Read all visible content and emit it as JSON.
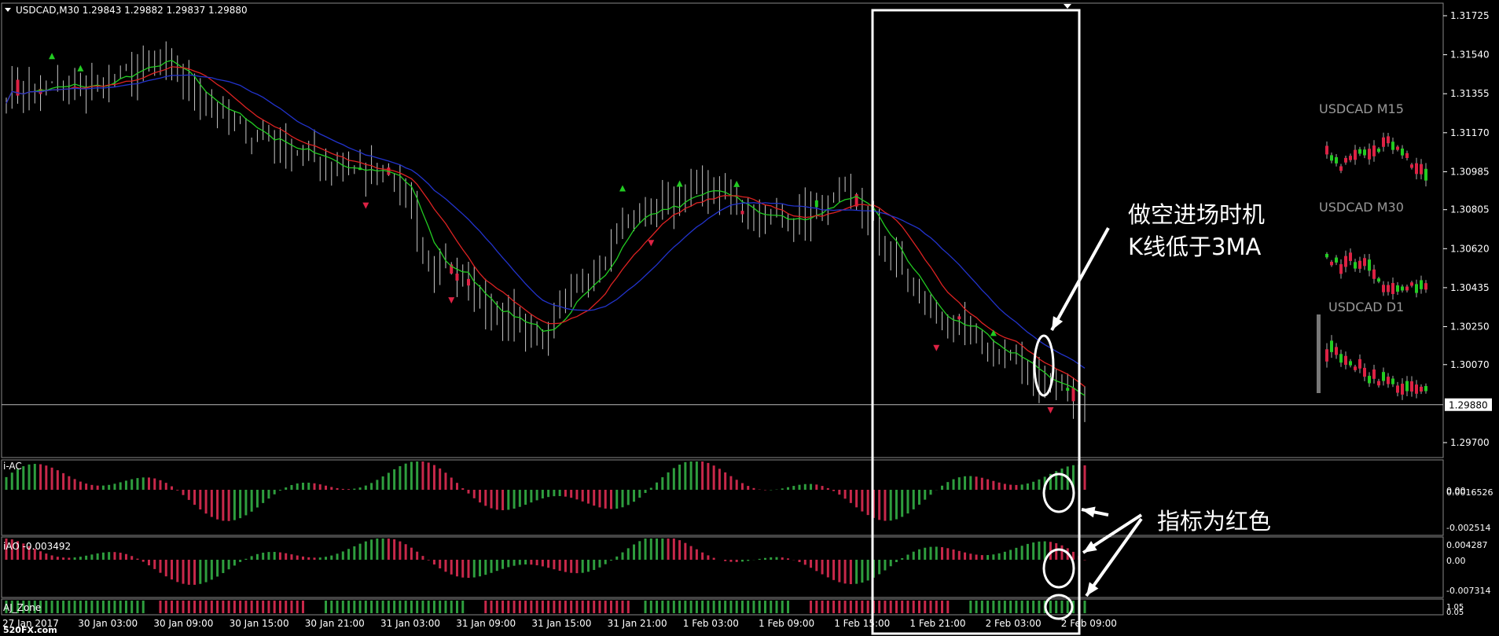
{
  "header": {
    "symbol_line": "USDCAD,M30  1.29843 1.29882 1.29837 1.29880"
  },
  "price_axis": {
    "ticks": [
      "1.31725",
      "1.31540",
      "1.31355",
      "1.31170",
      "1.30985",
      "1.30805",
      "1.30620",
      "1.30435",
      "1.30250",
      "1.30070",
      "1.29700"
    ],
    "tick_values": [
      1.31725,
      1.3154,
      1.31355,
      1.3117,
      1.30985,
      1.30805,
      1.3062,
      1.30435,
      1.3025,
      1.3007,
      1.297
    ],
    "current_price": "1.29880",
    "current_value": 1.2988
  },
  "time_axis": {
    "labels": [
      "27 Jan 2017",
      "30 Jan 03:00",
      "30 Jan 09:00",
      "30 Jan 15:00",
      "30 Jan 21:00",
      "31 Jan 03:00",
      "31 Jan 09:00",
      "31 Jan 15:00",
      "31 Jan 21:00",
      "1 Feb 03:00",
      "1 Feb 09:00",
      "1 Feb 15:00",
      "1 Feb 21:00",
      "2 Feb 03:00",
      "2 Feb 09:00"
    ]
  },
  "panels": {
    "ac": {
      "name": "i-AC",
      "ticks": [
        "0.0016526",
        "0.00",
        "-0.002514"
      ]
    },
    "ao": {
      "name": "iAO -0.003492",
      "ticks": [
        "0.004287",
        "0.00",
        "-0.007314"
      ]
    },
    "zone": {
      "name": "AJ_Zone",
      "ticks": [
        "1.05",
        "0.05"
      ]
    }
  },
  "mini_charts": [
    {
      "label": "USDCAD M15"
    },
    {
      "label": "USDCAD M30"
    },
    {
      "label": "USDCAD D1"
    }
  ],
  "annotations": {
    "entry_line1": "做空进场时机",
    "entry_line2": "K线低于3MA",
    "indicator_red": "指标为红色",
    "watermark": "520FX.com"
  },
  "colors": {
    "ma_fast": "#22cc22",
    "ma_mid": "#dd2222",
    "ma_slow": "#2233cc",
    "bar": "#c8c8c8",
    "bull": "#22cc22",
    "bear": "#dd2244",
    "hist_green": "#2e9e3e",
    "hist_red": "#c8284a"
  },
  "chart_data": {
    "type": "line",
    "title": "USDCAD,M30",
    "series": [
      {
        "name": "USDCAD",
        "x": [
          "27 Jan 2017",
          "30 Jan 03:00",
          "30 Jan 09:00",
          "30 Jan 15:00",
          "30 Jan 21:00",
          "31 Jan 03:00",
          "31 Jan 09:00",
          "31 Jan 15:00",
          "31 Jan 21:00",
          "1 Feb 03:00",
          "1 Feb 09:00",
          "1 Feb 15:00",
          "1 Feb 21:00",
          "2 Feb 03:00",
          "2 Feb 09:00"
        ],
        "values": [
          1.3137,
          1.3138,
          1.315,
          1.312,
          1.3105,
          1.3095,
          1.304,
          1.302,
          1.3075,
          1.309,
          1.3075,
          1.3085,
          1.303,
          1.301,
          1.2988
        ]
      }
    ],
    "ylim": [
      1.296,
      1.318
    ]
  }
}
